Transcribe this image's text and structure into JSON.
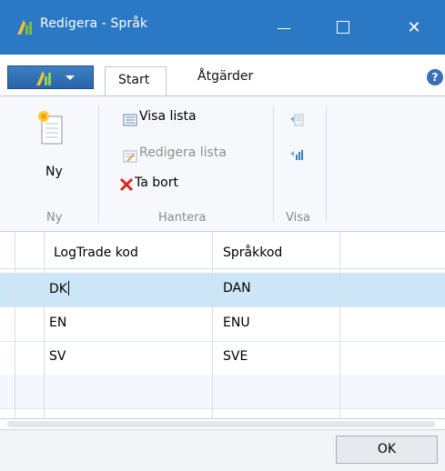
{
  "window": {
    "title": "Redigera - Språk",
    "controls": {
      "minimize": "—",
      "maximize": "☐",
      "close": "✕"
    }
  },
  "ribbon": {
    "tabs": [
      {
        "label": "Start",
        "active": true
      },
      {
        "label": "Åtgärder",
        "active": false
      }
    ],
    "help_icon": "?",
    "groups": {
      "ny": {
        "label": "Ny",
        "new_button": "Ny"
      },
      "hantera": {
        "label": "Hantera",
        "view_list": "Visa lista",
        "edit_list": "Redigera lista",
        "delete": "Ta bort"
      },
      "visa": {
        "label": "Visa"
      }
    }
  },
  "grid": {
    "columns": [
      "LogTrade kod",
      "Språkkod"
    ],
    "rows": [
      {
        "code": "DK",
        "lang": "DAN"
      },
      {
        "code": "EN",
        "lang": "ENU"
      },
      {
        "code": "SV",
        "lang": "SVE"
      }
    ]
  },
  "footer": {
    "ok_label": "OK"
  },
  "colors": {
    "titlebar": "#2b78c5",
    "selected_row": "#cde6f7",
    "delete_x": "#d9261c"
  }
}
